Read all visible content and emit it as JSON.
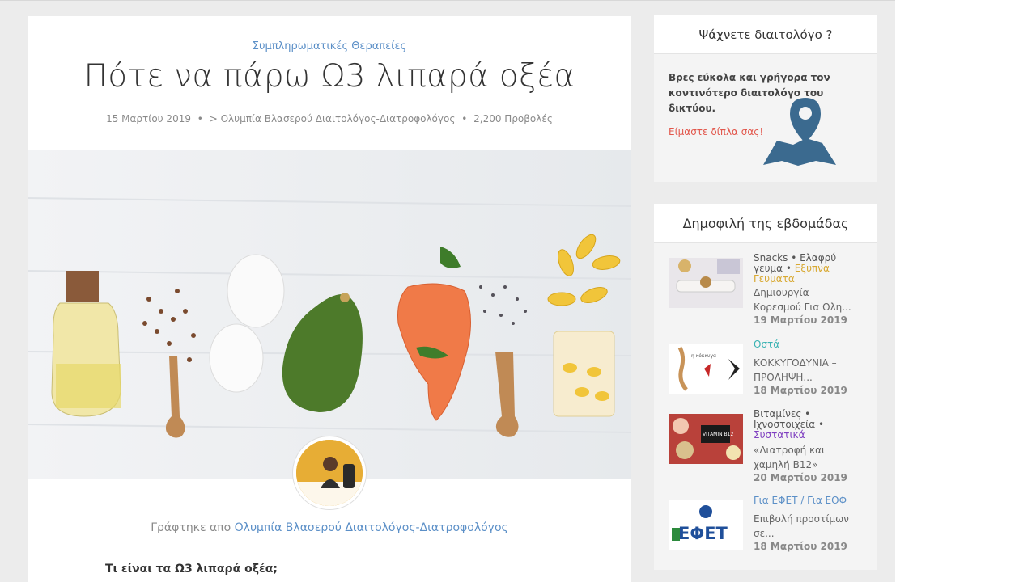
{
  "article": {
    "category": "Συμπληρωματικές Θεραπείες",
    "title": "Πότε να πάρω Ω3 λιπαρά οξέα",
    "meta": {
      "date": "15 Μαρτίου 2019",
      "author": "> Ολυμπία Βλασερού Διαιτολόγος-Διατροφολόγος",
      "views": "2,200 Προβολές"
    },
    "byline_prefix": "Γράφτηκε απο",
    "byline_author": "Ολυμπία Βλασερού Διαιτολόγος-Διατροφολόγος",
    "subheading": "Τι είναι τα Ω3 λιπαρά οξέα;"
  },
  "finder_widget": {
    "title": "Ψάχνετε διαιτολόγο ?",
    "description": "Βρες εύκολα και γρήγορα τον κοντινότερο διαιτολόγο του δικτύου.",
    "near_text": "Είμαστε δίπλα σας!"
  },
  "popular_widget": {
    "title": "Δημοφιλή της εβδομάδας",
    "posts": [
      {
        "categories": [
          "Snacks",
          "Ελαφρύ γευμα",
          "Εξυπνα Γευματα"
        ],
        "title": "Δημιουργία Κορεσμού Για Ολη...",
        "date": "19 Μαρτίου 2019"
      },
      {
        "categories": [
          "Οστά"
        ],
        "title": "ΚΟΚΚΥΓΟΔΥΝΙΑ – ΠΡΟΛΗΨΗ...",
        "date": "18 Μαρτίου 2019"
      },
      {
        "categories": [
          "Βιταμίνες",
          "Ιχνοστοιχεία",
          "Συστατικά"
        ],
        "title": "«Διατροφή και χαμηλή Β12»",
        "date": "20 Μαρτίου 2019"
      },
      {
        "categories": [
          "Για ΕΦΕΤ / Για ΕΟΦ"
        ],
        "title": "Επιβολή προστίμων σε...",
        "date": "18 Μαρτίου 2019"
      }
    ],
    "efet_logo_text": "ΕΦΕΤ",
    "vitamin_label": "VITAMIN B12"
  },
  "colors": {
    "link": "#5b8fc7",
    "accent_red": "#e2574c",
    "map_icon": "#3b6a8f"
  }
}
